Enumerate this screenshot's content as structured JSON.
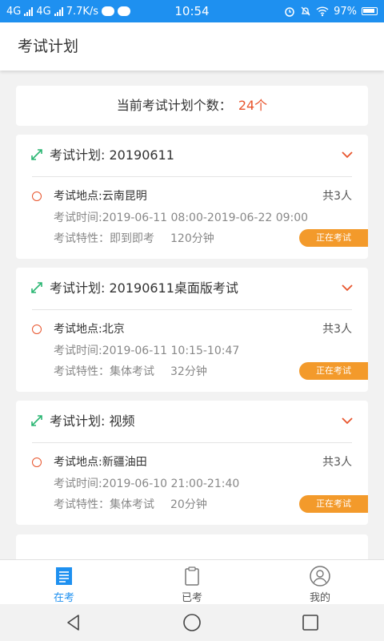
{
  "status_bar": {
    "network1": "4G",
    "network2": "4G",
    "speed": "7.7K/s",
    "time": "10:54",
    "battery": "97%"
  },
  "app_bar": {
    "title": "考试计划"
  },
  "summary": {
    "label": "当前考试计划个数：",
    "count": "24个"
  },
  "plans": [
    {
      "title": "考试计划: 20190611",
      "location": "考试地点:云南昆明",
      "people": "共3人",
      "time": "考试时间:2019-06-11 08:00-2019-06-22 09:00",
      "attribute": "考试特性：即到即考",
      "duration": "120分钟",
      "status": "正在考试"
    },
    {
      "title": "考试计划: 20190611桌面版考试",
      "location": "考试地点:北京",
      "people": "共3人",
      "time": "考试时间:2019-06-11 10:15-10:47",
      "attribute": "考试特性：集体考试",
      "duration": "32分钟",
      "status": "正在考试"
    },
    {
      "title": "考试计划: 视频",
      "location": "考试地点:新疆油田",
      "people": "共3人",
      "time": "考试时间:2019-06-10 21:00-21:40",
      "attribute": "考试特性：集体考试",
      "duration": "20分钟",
      "status": "正在考试"
    }
  ],
  "bottom_nav": [
    {
      "label": "在考",
      "icon": "list-icon",
      "active": true
    },
    {
      "label": "已考",
      "icon": "clipboard-icon",
      "active": false
    },
    {
      "label": "我的",
      "icon": "user-icon",
      "active": false
    }
  ],
  "colors": {
    "primary": "#1e90f0",
    "accent": "#e8542c",
    "badge": "#f39a2b"
  }
}
